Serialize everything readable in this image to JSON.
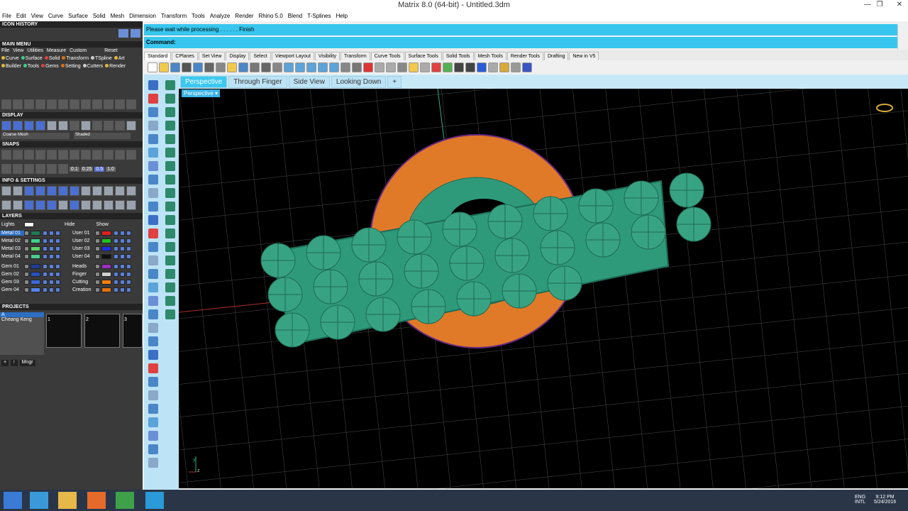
{
  "window": {
    "title": "Matrix 8.0 (64-bit) - Untitled.3dm",
    "minimize": "—",
    "restore": "❐",
    "close": "✕"
  },
  "menu": [
    "File",
    "Edit",
    "View",
    "Curve",
    "Surface",
    "Solid",
    "Mesh",
    "Dimension",
    "Transform",
    "Tools",
    "Analyze",
    "Render",
    "Rhino 5.0",
    "Blend",
    "T-Splines",
    "Help"
  ],
  "left_panel": {
    "icon_history": "ICON HISTORY",
    "main_menu": "MAIN MENU",
    "main_menu_row1": [
      "File",
      "View",
      "Utilities",
      "Measure",
      "Custom"
    ],
    "main_menu_reset": "Reset",
    "main_menu_row2": [
      "Curve",
      "Surface",
      "Solid",
      "Transform",
      "TSpline",
      "Art"
    ],
    "main_menu_row3": [
      "Builder",
      "Tools",
      "Gems",
      "Setting",
      "Cutters",
      "Render"
    ],
    "display": "DISPLAY",
    "display_mode_left": "Coarse Mesh",
    "display_mode_right": "Shaded",
    "snaps": "SNAPS",
    "snap_values": [
      "0.1",
      "0.25",
      "0.5",
      "1.0"
    ],
    "info_settings": "INFO & SETTINGS",
    "layers": "LAYERS",
    "lights": "Lights",
    "hide": "Hide",
    "show": "Show",
    "layers_left": [
      {
        "name": "Metal 01",
        "color": "#1e7a55",
        "selected": true
      },
      {
        "name": "Metal 02",
        "color": "#3fcf8c"
      },
      {
        "name": "Metal 03",
        "color": "#5fd06a"
      },
      {
        "name": "Metal 04",
        "color": "#4bcc90"
      },
      {
        "name": "Gem 01",
        "color": "#1d3f9a"
      },
      {
        "name": "Gem 02",
        "color": "#2a50c0"
      },
      {
        "name": "Gem 03",
        "color": "#3c68d8"
      },
      {
        "name": "Gem 04",
        "color": "#5585e8"
      }
    ],
    "layers_right": [
      {
        "name": "User 01",
        "color": "#e02020"
      },
      {
        "name": "User 02",
        "color": "#22c022"
      },
      {
        "name": "User 03",
        "color": "#2030e0"
      },
      {
        "name": "User 04",
        "color": "#101010"
      },
      {
        "name": "Heads",
        "color": "#9a30c0"
      },
      {
        "name": "Finger",
        "color": "#d0d0d0"
      },
      {
        "name": "Cutting",
        "color": "#f08010"
      },
      {
        "name": "Creation",
        "color": "#e07010"
      }
    ],
    "projects": "PROJECTS",
    "project_selected": "A",
    "project_name": "Cheang Keng",
    "thumb_numbers": [
      "1",
      "2",
      "3"
    ],
    "mngr": "Mngr"
  },
  "status": {
    "message": "Please wait while processing . . . . . . Finish",
    "command_label": "Command:"
  },
  "toolbar_tabs": [
    "Standard",
    "CPlanes",
    "Set View",
    "Display",
    "Select",
    "Viewport Layout",
    "Visibility",
    "Transform",
    "Curve Tools",
    "Surface Tools",
    "Solid Tools",
    "Mesh Tools",
    "Render Tools",
    "Drafting",
    "New in V5"
  ],
  "toolbar_icon_colors": [
    "#fff",
    "#f2c94c",
    "#4a86c8",
    "#555",
    "#4a86c8",
    "#666",
    "#888",
    "#f2c94c",
    "#4a86c8",
    "#777",
    "#666",
    "#888",
    "#5ba3d9",
    "#5ba3d9",
    "#5ba3d9",
    "#5ba3d9",
    "#5ba3d9",
    "#888",
    "#777",
    "#d33",
    "#aaa",
    "#aaa",
    "#888",
    "#f2c94c",
    "#aaa",
    "#e04040",
    "#55b055",
    "#444",
    "#444",
    "#2a5bd7",
    "#aaa",
    "#d7a83a",
    "#999",
    "#3a55c5"
  ],
  "viewport_tabs": [
    "Perspective",
    "Through Finger",
    "Side View",
    "Looking Down"
  ],
  "viewport_add": "+",
  "viewport": {
    "label": "Perspective",
    "label_arrow": "▾",
    "axis_y": "y",
    "axis_z": "z"
  },
  "taskbar": {
    "lang": "ENG",
    "lang2": "INTL",
    "time": "9:12 PM",
    "date": "5/24/2016"
  },
  "colors": {
    "accent": "#38c6ee",
    "panel": "#3a3a3a",
    "ring_orange": "#e07a28",
    "ring_green": "#2e9a7a",
    "tab_active": "#3cc8f0"
  }
}
